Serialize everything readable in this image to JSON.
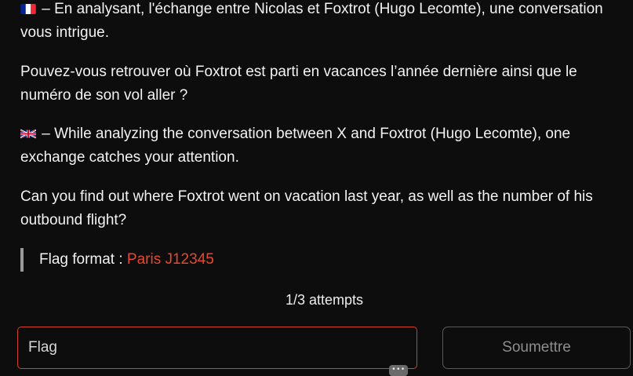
{
  "challenge": {
    "fr": {
      "flag_icon": "french-flag",
      "line1": "– En analysant, l'échange entre Nicolas et Foxtrot (Hugo Lecomte), une conversation vous intrigue.",
      "line2": "Pouvez-vous retrouver où Foxtrot est parti en vacances l’année dernière ainsi que le numéro de son vol aller ?"
    },
    "en": {
      "flag_icon": "uk-flag",
      "line1": "– While analyzing the conversation between X and Foxtrot (Hugo Lecomte), one exchange catches your attention.",
      "line2": "Can you find out where Foxtrot went on vacation last year, as well as the number of his outbound flight?"
    },
    "flag_format": {
      "label": "Flag format : ",
      "example": "Paris J12345"
    }
  },
  "attempts": "1/3 attempts",
  "form": {
    "input_placeholder": "Flag",
    "input_value": "",
    "submit_label": "Soumettre",
    "grip_label": "•••"
  },
  "colors": {
    "background": "#0d0d0d",
    "text": "#f2f2f2",
    "accent": "#e8472e",
    "input_border": "#d2432a",
    "button_border": "#5a5a5a",
    "button_text": "#8d8d8d"
  }
}
